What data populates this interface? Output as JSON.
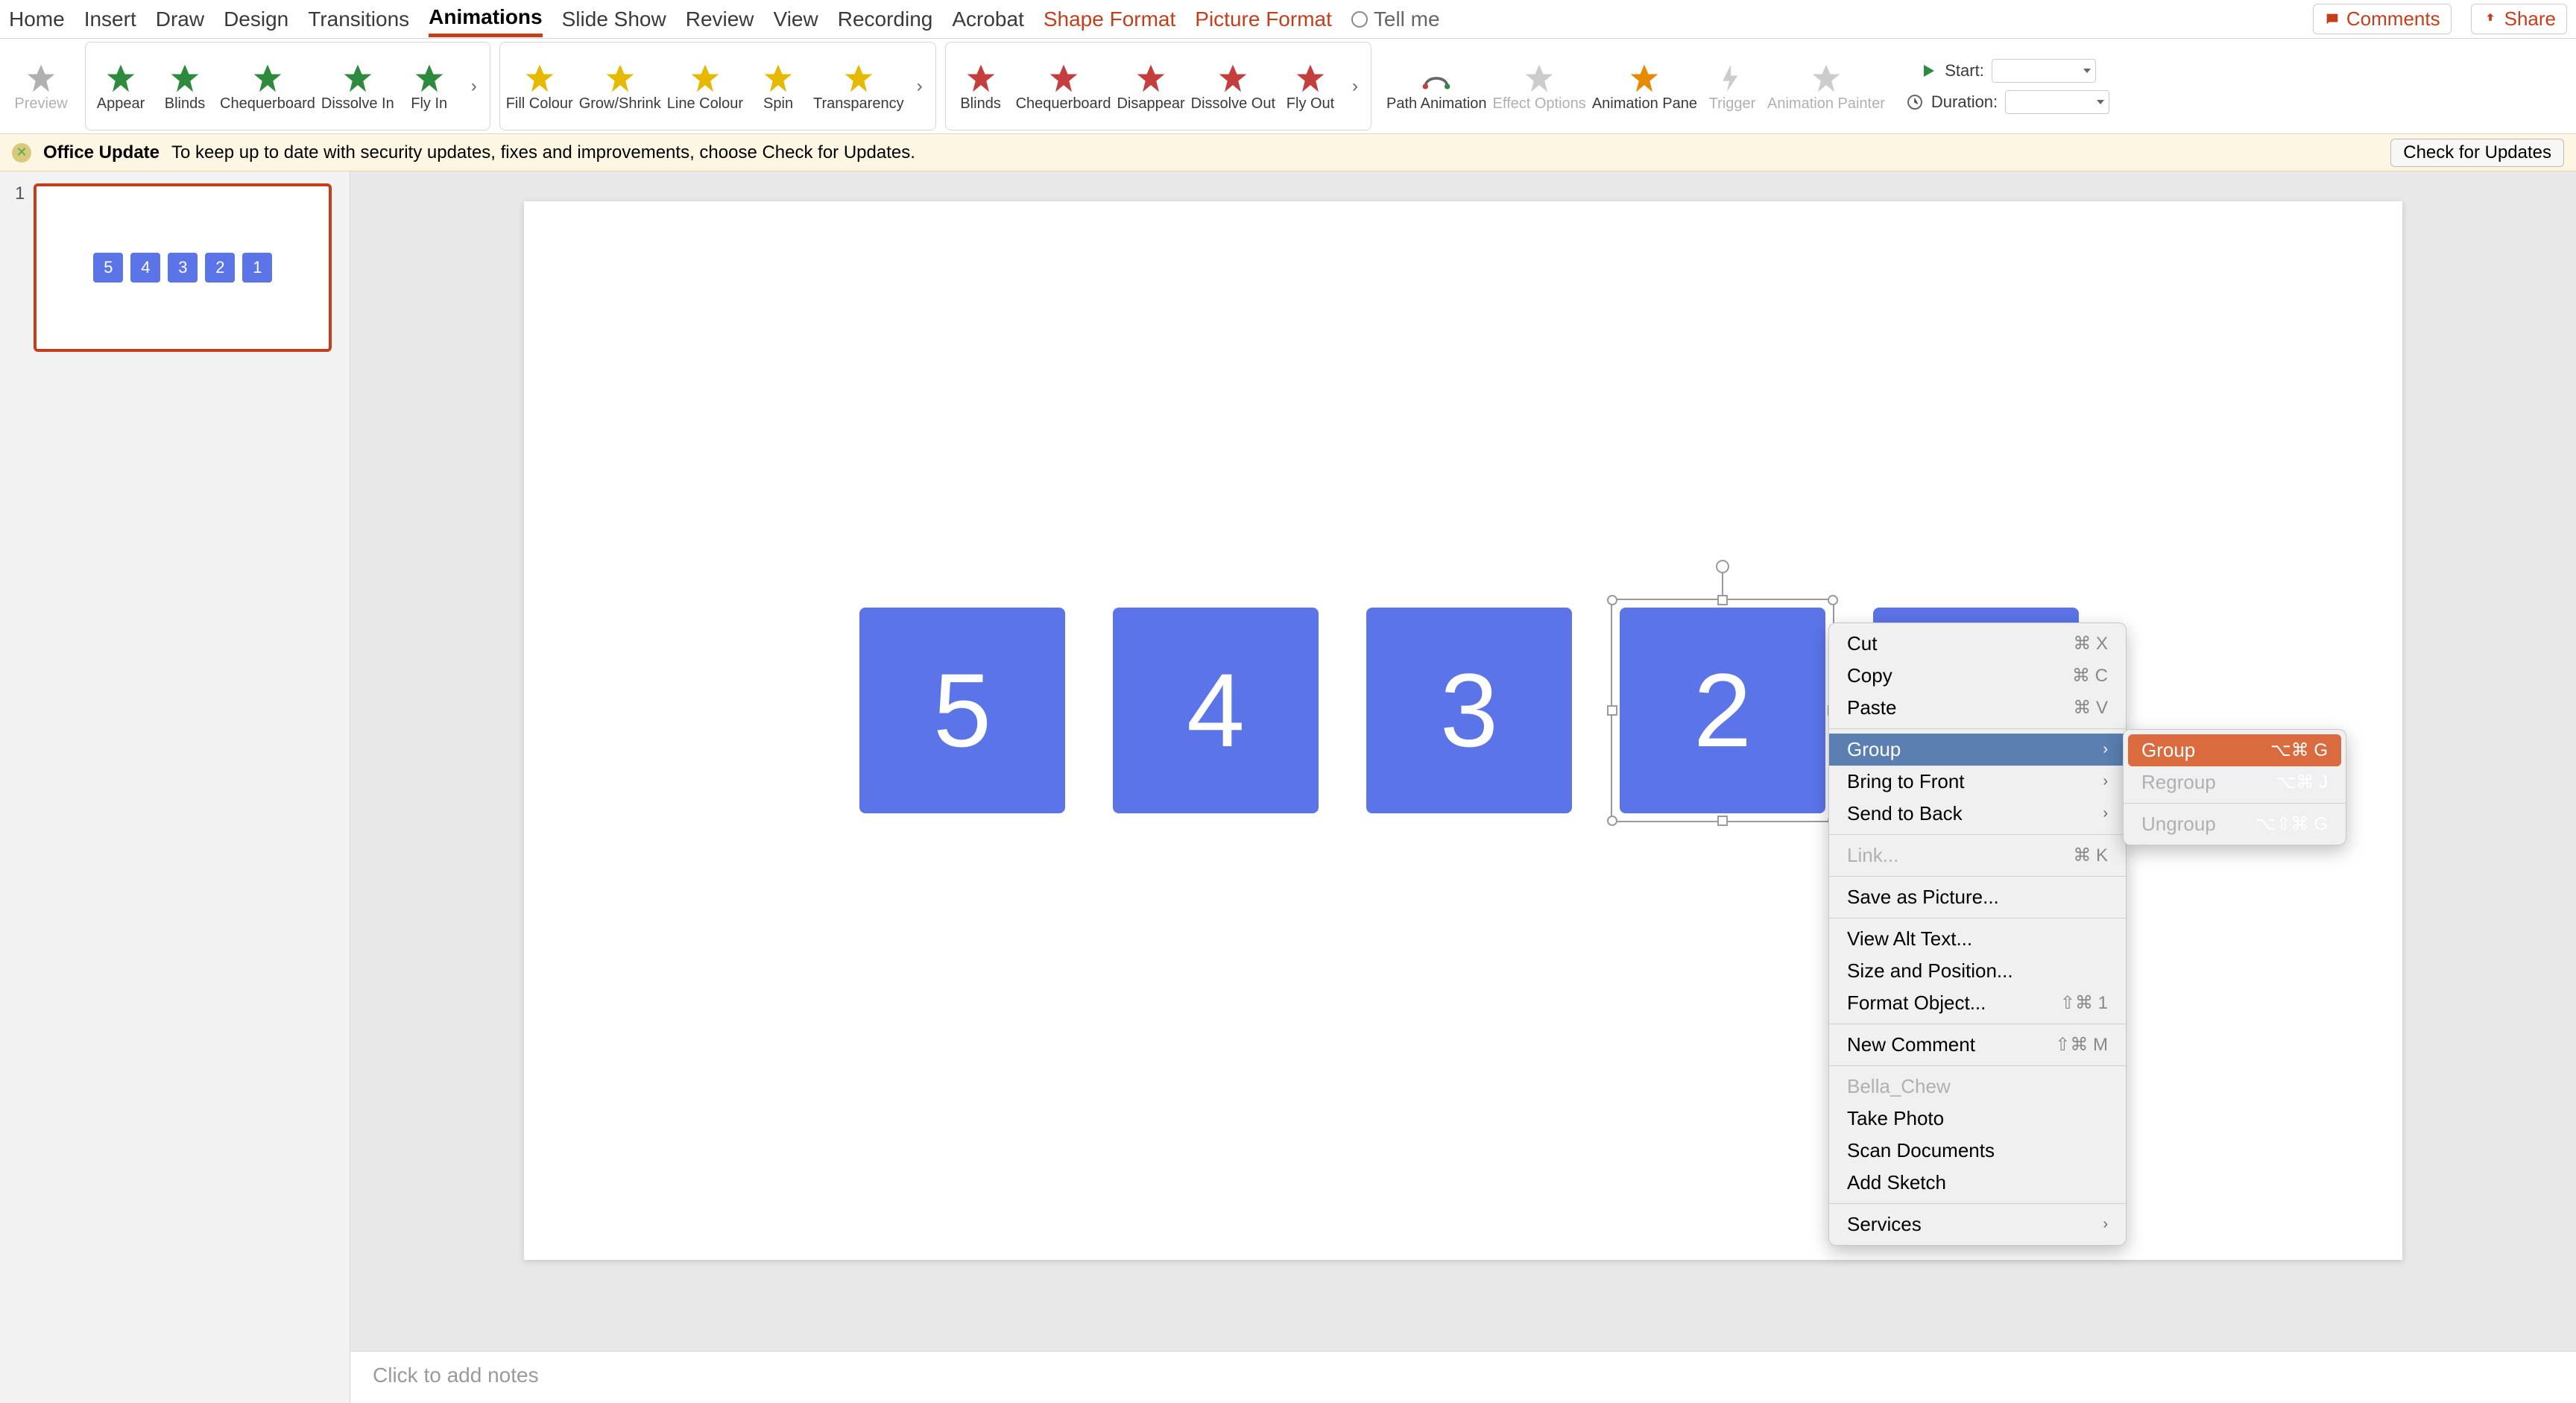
{
  "tabs": {
    "home": "Home",
    "insert": "Insert",
    "draw": "Draw",
    "design": "Design",
    "transitions": "Transitions",
    "animations": "Animations",
    "slideshow": "Slide Show",
    "review": "Review",
    "view": "View",
    "recording": "Recording",
    "acrobat": "Acrobat",
    "shapeformat": "Shape Format",
    "pictureformat": "Picture Format",
    "tellme": "Tell me"
  },
  "header": {
    "comments": "Comments",
    "share": "Share"
  },
  "ribbon": {
    "preview": "Preview",
    "entrance": {
      "appear": "Appear",
      "blinds": "Blinds",
      "cheq": "Chequerboard",
      "dissolvein": "Dissolve In",
      "flyin": "Fly In"
    },
    "emphasis": {
      "fill": "Fill Colour",
      "grow": "Grow/Shrink",
      "line": "Line Colour",
      "spin": "Spin",
      "trans": "Transparency"
    },
    "exit": {
      "blinds": "Blinds",
      "cheq": "Chequerboard",
      "disappear": "Disappear",
      "dissolveout": "Dissolve Out",
      "flyout": "Fly Out"
    },
    "adv": {
      "path": "Path Animation",
      "effect": "Effect Options",
      "pane": "Animation Pane",
      "trigger": "Trigger",
      "painter": "Animation Painter"
    },
    "timing": {
      "start": "Start:",
      "duration": "Duration:"
    }
  },
  "update": {
    "title": "Office Update",
    "msg": "To keep up to date with security updates, fixes and improvements, choose Check for Updates.",
    "btn": "Check for Updates"
  },
  "thumb": {
    "num": "1",
    "minis": [
      "5",
      "4",
      "3",
      "2",
      "1"
    ]
  },
  "shapes": {
    "s1": "5",
    "s2": "4",
    "s3": "3",
    "s4": "2"
  },
  "notes": "Click to add notes",
  "ctx": {
    "cut": "Cut",
    "cut_sc": "⌘ X",
    "copy": "Copy",
    "copy_sc": "⌘ C",
    "paste": "Paste",
    "paste_sc": "⌘ V",
    "group": "Group",
    "front": "Bring to Front",
    "back": "Send to Back",
    "link": "Link...",
    "link_sc": "⌘ K",
    "savepic": "Save as Picture...",
    "alt": "View Alt Text...",
    "size": "Size and Position...",
    "format": "Format Object...",
    "format_sc": "⇧⌘ 1",
    "comment": "New Comment",
    "comment_sc": "⇧⌘ M",
    "user": "Bella_Chew",
    "photo": "Take Photo",
    "scan": "Scan Documents",
    "sketch": "Add Sketch",
    "services": "Services"
  },
  "sub": {
    "group": "Group",
    "group_sc": "⌥⌘ G",
    "regroup": "Regroup",
    "regroup_sc": "⌥⌘ J",
    "ungroup": "Ungroup",
    "ungroup_sc": "⌥⇧⌘ G"
  }
}
